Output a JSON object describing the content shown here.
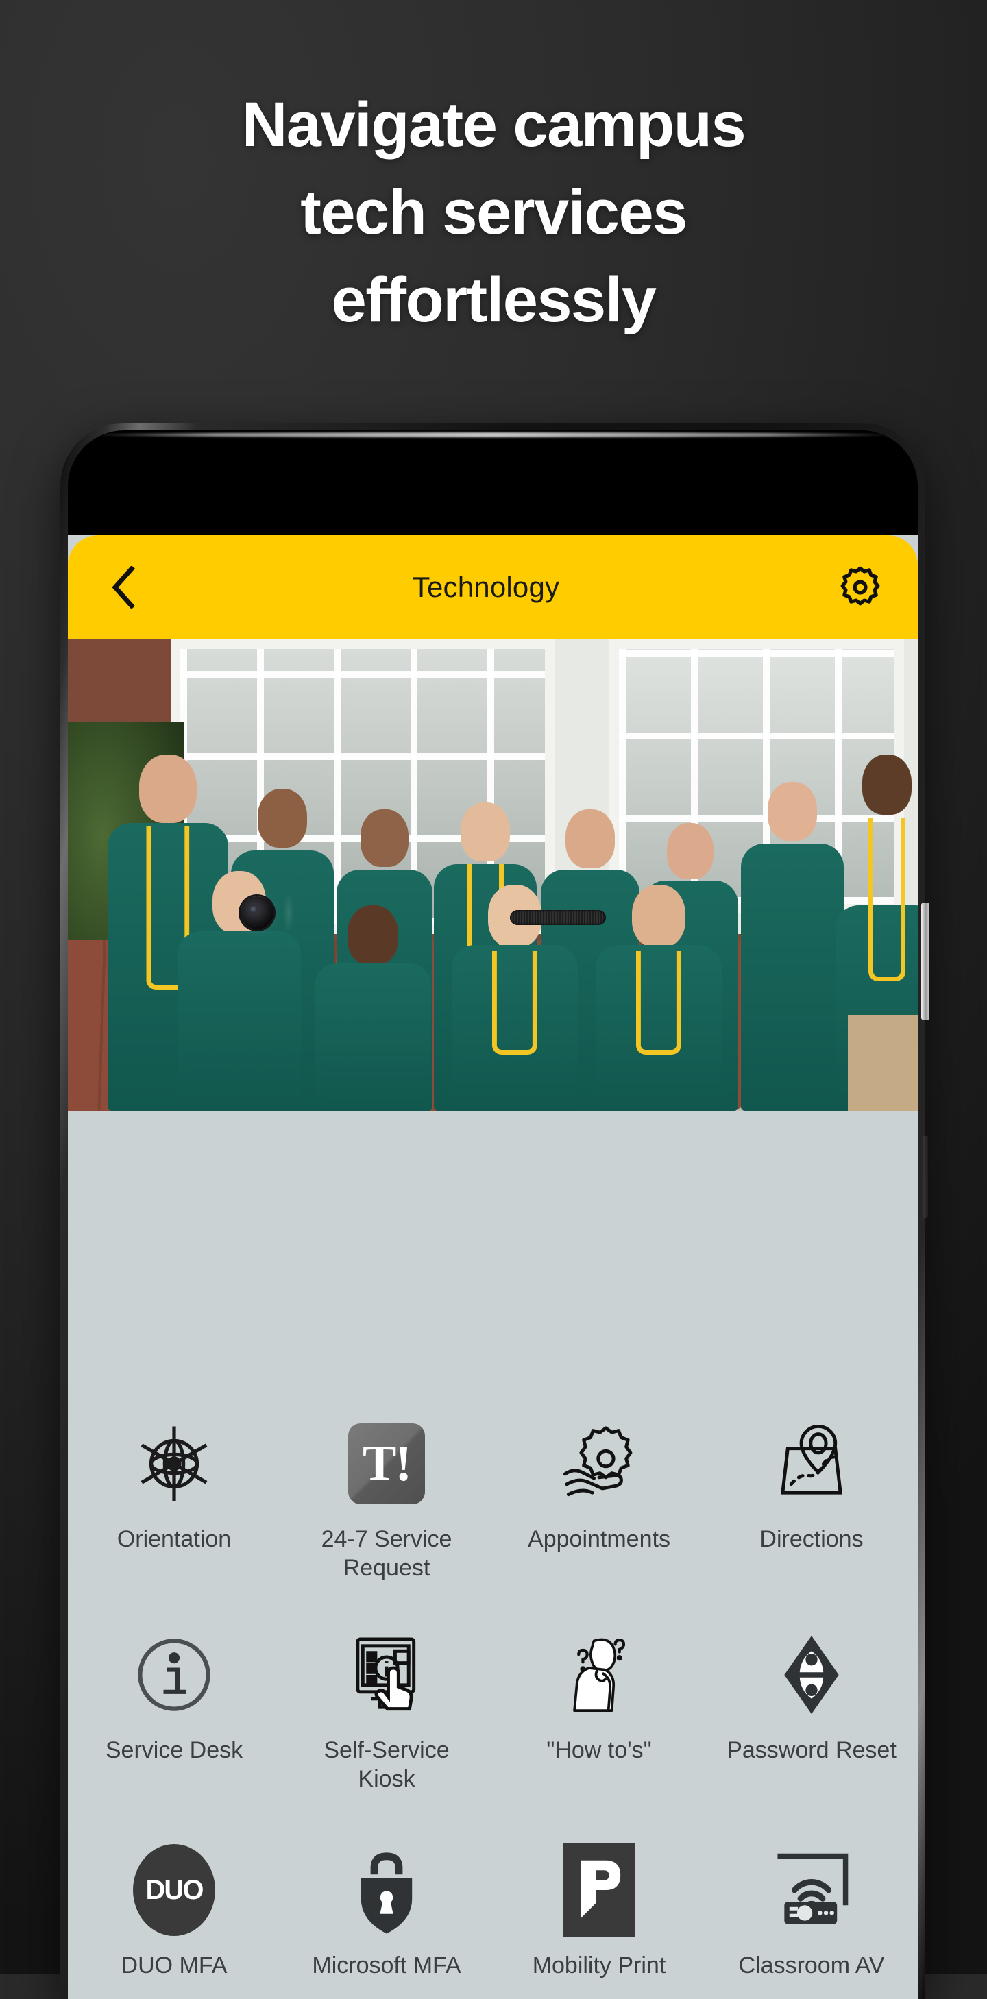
{
  "promo": {
    "headline_lines": [
      "Navigate campus",
      "tech services",
      "effortlessly"
    ],
    "background_color": "#2a2a2a",
    "text_color": "#ffffff"
  },
  "app": {
    "accent_color": "#ffcc00",
    "screen_background": "#cbd2d3",
    "appbar": {
      "title": "Technology",
      "back_icon": "chevron-left-icon",
      "settings_icon": "gear-icon",
      "title_color": "#1a1a1a"
    },
    "hero": {
      "alt": "Group photo of campus technology services staff in teal polo shirts outside a brick building"
    },
    "grid": {
      "rows": [
        [
          {
            "label": "Orientation",
            "icon": "ship-wheel-icon"
          },
          {
            "label": "24-7 Service Request",
            "icon": "t-exclamation-badge-icon"
          },
          {
            "label": "Appointments",
            "icon": "gear-in-hand-icon"
          },
          {
            "label": "Directions",
            "icon": "map-pin-icon"
          }
        ],
        [
          {
            "label": "Service Desk",
            "icon": "info-circle-icon"
          },
          {
            "label": "Self-Service Kiosk",
            "icon": "kiosk-touch-icon"
          },
          {
            "label": "\"How to's\"",
            "icon": "thinking-person-icon"
          },
          {
            "label": "Password Reset",
            "icon": "diamond-key-icon"
          }
        ],
        [
          {
            "label": "DUO MFA",
            "icon": "duo-oval-icon",
            "glyph": "DUO"
          },
          {
            "label": "Microsoft MFA",
            "icon": "padlock-shield-icon"
          },
          {
            "label": "Mobility Print",
            "icon": "papercut-p-icon",
            "glyph": "P"
          },
          {
            "label": "Classroom AV",
            "icon": "projector-wifi-icon"
          }
        ]
      ]
    }
  }
}
